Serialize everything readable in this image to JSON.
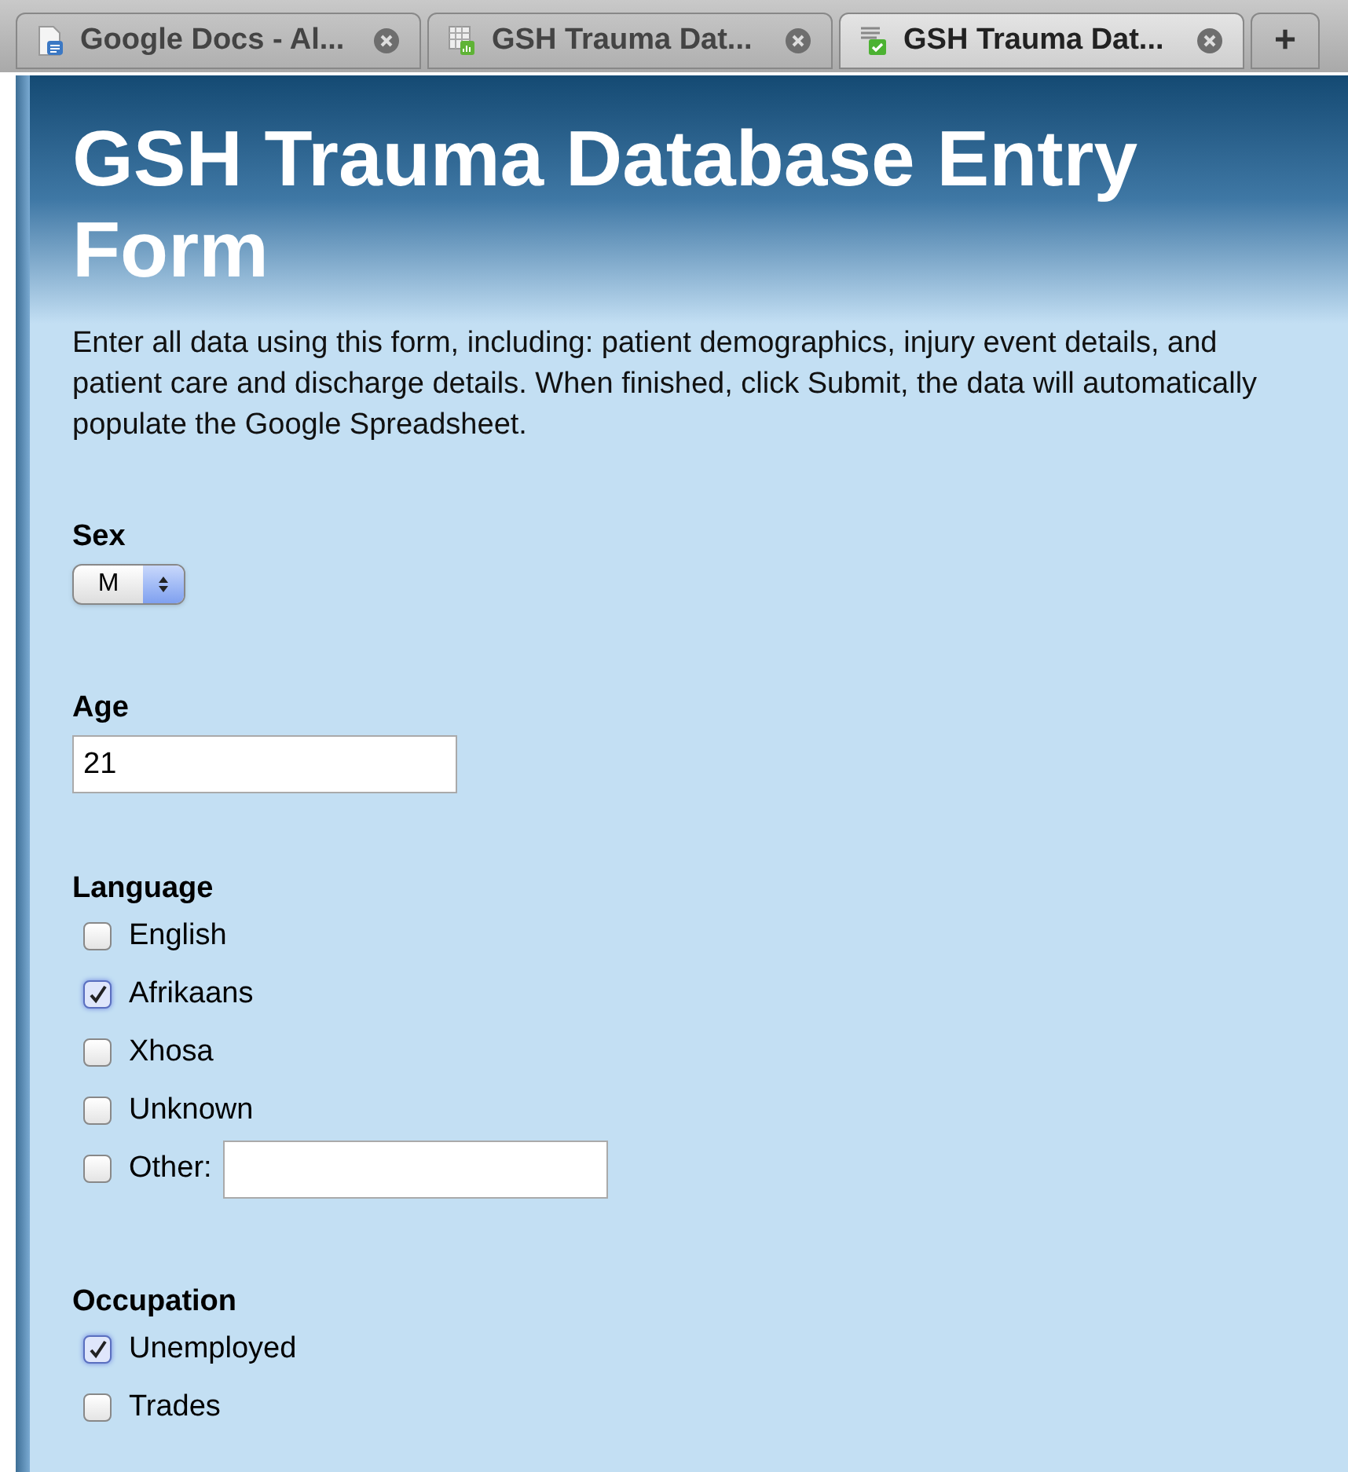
{
  "tabs": [
    {
      "label": "Google Docs - Al...",
      "kind": "doc",
      "selected": false
    },
    {
      "label": "GSH Trauma Dat...",
      "kind": "sheet",
      "selected": false
    },
    {
      "label": "GSH Trauma Dat...",
      "kind": "form",
      "selected": true
    }
  ],
  "new_tab": "+",
  "form": {
    "title": "GSH Trauma Database Entry Form",
    "description": "Enter all data using this form, including: patient demographics, injury event details, and patient care and discharge details. When finished, click Submit, the data will automatically populate the Google Spreadsheet.",
    "questions": [
      {
        "kind": "select",
        "label": "Sex",
        "value": "M"
      },
      {
        "kind": "text",
        "label": "Age",
        "value": "21"
      },
      {
        "kind": "checkboxes",
        "label": "Language",
        "options": [
          {
            "kind": "plain",
            "label": "English",
            "checked": false
          },
          {
            "kind": "plain",
            "label": "Afrikaans",
            "checked": true
          },
          {
            "kind": "plain",
            "label": "Xhosa",
            "checked": false
          },
          {
            "kind": "plain",
            "label": "Unknown",
            "checked": false
          },
          {
            "kind": "other",
            "label": "Other:",
            "checked": false
          }
        ]
      },
      {
        "kind": "checkboxes",
        "label": "Occupation",
        "options": [
          {
            "kind": "plain",
            "label": "Unemployed",
            "checked": true
          },
          {
            "kind": "plain",
            "label": "Trades",
            "checked": false
          }
        ]
      }
    ]
  }
}
